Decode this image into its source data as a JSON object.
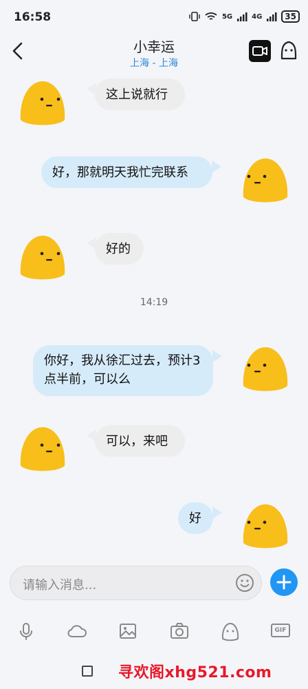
{
  "status": {
    "time": "16:58",
    "signal1": "5G",
    "signal2": "4G",
    "battery": "35"
  },
  "header": {
    "title": "小幸运",
    "subtitle": "上海 - 上海"
  },
  "messages": [
    {
      "side": "in",
      "text": "这上说就行"
    },
    {
      "side": "out",
      "text": "好，那就明天我忙完联系"
    },
    {
      "side": "in",
      "text": "好的"
    },
    {
      "side": "out",
      "text": "你好，我从徐汇过去，预计3点半前，可以么"
    },
    {
      "side": "in",
      "text": "可以，来吧"
    },
    {
      "side": "out",
      "text": "好"
    }
  ],
  "timestamp": "14:19",
  "input": {
    "placeholder": "请输入消息..."
  },
  "toolbar": {
    "icons": [
      "microphone-icon",
      "cloud-icon",
      "image-icon",
      "camera-icon",
      "sticker-icon",
      "gif-icon"
    ],
    "gif_label": "GIF"
  },
  "watermark": "寻欢阁xhg521.com",
  "colors": {
    "accent": "#2196f3",
    "bubble_out": "#d6ebfa",
    "bubble_in": "#ededed",
    "avatar": "#f8be1a"
  }
}
